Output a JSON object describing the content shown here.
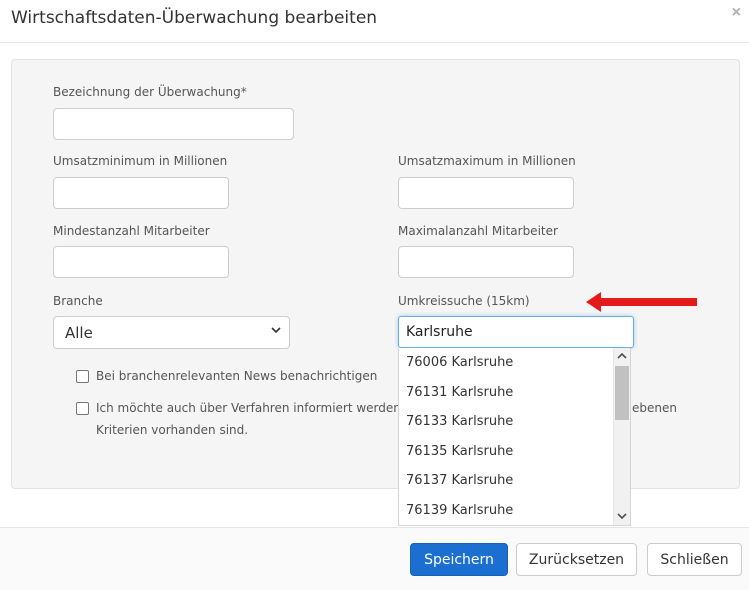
{
  "modal": {
    "title": "Wirtschaftsdaten-Überwachung bearbeiten",
    "close_glyph": "×"
  },
  "form": {
    "name_label": "Bezeichnung der Überwachung*",
    "name_value": "",
    "revenue_min_label": "Umsatzminimum in Millionen",
    "revenue_min_value": "",
    "revenue_max_label": "Umsatzmaximum in Millionen",
    "revenue_max_value": "",
    "employees_min_label": "Mindestanzahl Mitarbeiter",
    "employees_min_value": "",
    "employees_max_label": "Maximalanzahl Mitarbeiter",
    "employees_max_value": "",
    "branch_label": "Branche",
    "branch_value": "Alle",
    "radius_label": "Umkreissuche (15km)",
    "radius_value": "Karlsruhe",
    "checkbox_news": {
      "label": "Bei branchenrelevanten News benachrichtigen",
      "checked": false
    },
    "checkbox_procedures": {
      "line1_start": "Ich möchte auch über Verfahren informiert werden, bei",
      "line1_end": "ebenen",
      "line2": "Kriterien vorhanden sind.",
      "checked": false
    }
  },
  "autocomplete": {
    "items": [
      "76006 Karlsruhe",
      "76131 Karlsruhe",
      "76133 Karlsruhe",
      "76135 Karlsruhe",
      "76137 Karlsruhe",
      "76139 Karlsruhe"
    ]
  },
  "footer": {
    "save_label": "Speichern",
    "reset_label": "Zurücksetzen",
    "close_label": "Schließen"
  },
  "colors": {
    "primary": "#1a6fd1",
    "annotation_arrow": "#e31b1b",
    "focus_border": "#66afe9"
  },
  "icons": {
    "close": "close-icon",
    "select_chevron": "chevron-down-icon",
    "scroll_up": "chevron-up-icon",
    "scroll_down": "chevron-down-icon",
    "annotation": "red-arrow-icon"
  }
}
